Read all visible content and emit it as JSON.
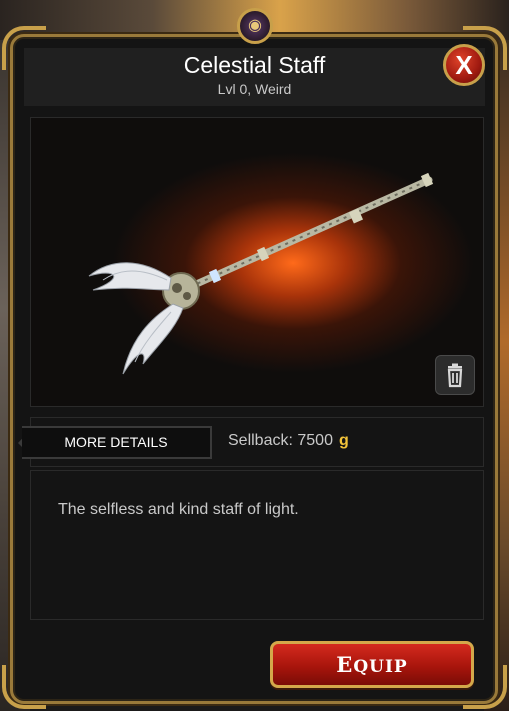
{
  "item": {
    "name": "Celestial Staff",
    "level_line": "Lvl 0, Weird"
  },
  "window": {
    "emblem_icon": "guild-emblem-icon",
    "close_label": "X"
  },
  "actions": {
    "more_details_label": "MORE DETAILS",
    "equip_label": "Equip",
    "trash_icon": "trash-icon"
  },
  "sellback": {
    "label": "Sellback: 7500",
    "currency": "g"
  },
  "description": "The selfless and kind staff of light.",
  "colors": {
    "gold_trim": "#c8a04a",
    "equip_red": "#c21f14",
    "currency_gold": "#f2c33a",
    "glow_orange": "#ff6a1a"
  }
}
